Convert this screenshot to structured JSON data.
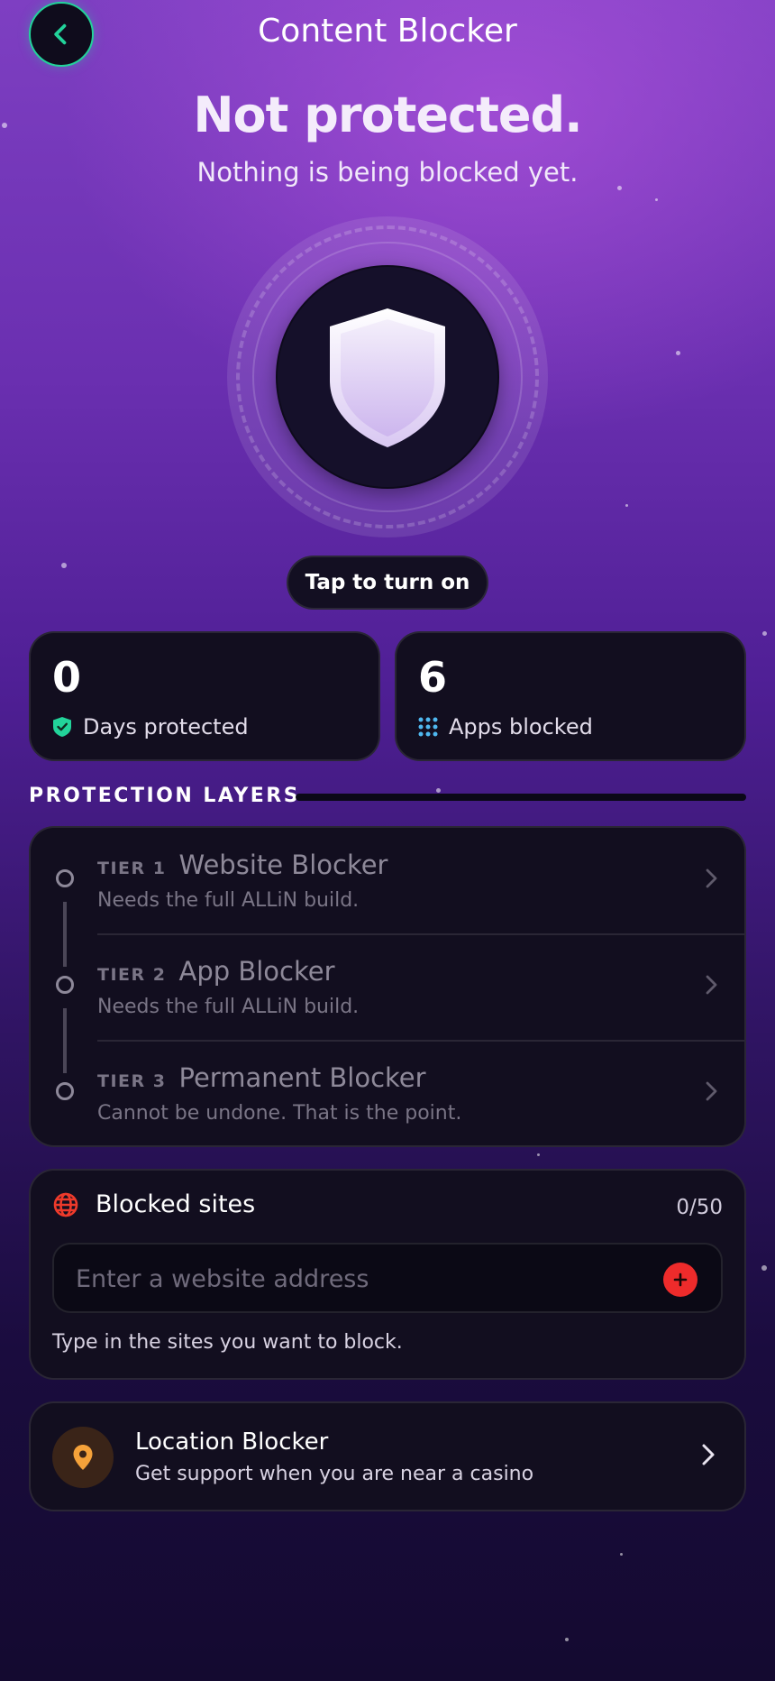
{
  "header": {
    "title": "Content Blocker"
  },
  "status": {
    "title": "Not protected.",
    "subtitle": "Nothing is being blocked yet."
  },
  "toggle": {
    "label": "Tap to turn on"
  },
  "stats": [
    {
      "value": "0",
      "label": "Days protected",
      "icon": "shield-check-icon"
    },
    {
      "value": "6",
      "label": "Apps blocked",
      "icon": "apps-grid-icon"
    }
  ],
  "layers": {
    "header": "PROTECTION LAYERS",
    "tiers": [
      {
        "tag": "TIER 1",
        "name": "Website Blocker",
        "desc": "Needs the full ALLiN build."
      },
      {
        "tag": "TIER 2",
        "name": "App Blocker",
        "desc": "Needs the full ALLiN build."
      },
      {
        "tag": "TIER 3",
        "name": "Permanent Blocker",
        "desc": "Cannot be undone. That is the point."
      }
    ]
  },
  "blocked_sites": {
    "title": "Blocked sites",
    "count": "0/50",
    "placeholder": "Enter a website address",
    "hint": "Type in the sites you want to block."
  },
  "location_blocker": {
    "title": "Location Blocker",
    "subtitle": "Get support when you are near a casino"
  },
  "colors": {
    "accent_green": "#22d39a",
    "danger_red": "#ee2b2b",
    "location_orange": "#f5a23a",
    "apps_blue": "#4fb8f0"
  }
}
